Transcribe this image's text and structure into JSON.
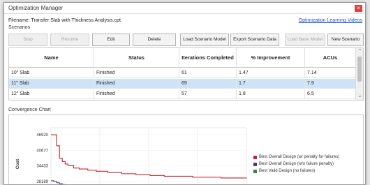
{
  "window": {
    "title": "Optimization Manager",
    "close_glyph": "×"
  },
  "file": {
    "line": "Filename: Transfer Slab with Thickness Analysis.cpt",
    "help_link": "Optimization Learning Videos"
  },
  "scenarios_label": "Scenarios",
  "toolbar": {
    "stop": "Stop",
    "resume": "Resume",
    "edit": "Edit",
    "delete": "Delete",
    "load_scenario_model": "Load Scenario Model",
    "export_scenario_data": "Export Scenario Data",
    "load_base_model": "Load Base Model",
    "new_scenario": "New Scenario"
  },
  "table": {
    "columns": [
      "Name",
      "Status",
      "Iterations Completed",
      "% Improvement",
      "ACUs"
    ],
    "rows": [
      {
        "name": "10\" Slab",
        "status": "Finished",
        "iterations": "61",
        "improvement": "1.47",
        "acus": "7.14",
        "selected": false
      },
      {
        "name": "11\" Slab",
        "status": "Finished",
        "iterations": "69",
        "improvement": "1.7",
        "acus": "7.9",
        "selected": true
      },
      {
        "name": "12\" Slab",
        "status": "Finished",
        "iterations": "57",
        "improvement": "1.8",
        "acus": "6.5",
        "selected": false
      }
    ]
  },
  "chart_title": "Convergence Chart",
  "chart_data": {
    "type": "line",
    "title": "",
    "xlabel": "",
    "ylabel": "Cost",
    "yticks": [
      46920,
      40677,
      34433,
      28189
    ],
    "ylim": [
      26500,
      48000
    ],
    "xlim": [
      0,
      69
    ],
    "grid": true,
    "legend": "right",
    "series": [
      {
        "name": "Best Overall Design (w/ penalty for failures)",
        "color": "#c8232c",
        "x": [
          0,
          1,
          2,
          3,
          4,
          5,
          6,
          8,
          10,
          13,
          16,
          20,
          25,
          30,
          35,
          40,
          50,
          60,
          69
        ],
        "y": [
          46920,
          46900,
          42500,
          37500,
          36200,
          35200,
          34600,
          33600,
          33200,
          32700,
          32300,
          31800,
          31300,
          30900,
          30600,
          30300,
          29900,
          29600,
          29400
        ]
      },
      {
        "name": "Best Overall Design (w/o failure penalty)",
        "color": "#5b2c8f",
        "x": [
          0,
          1,
          2,
          3,
          4,
          5,
          7,
          10
        ],
        "y": [
          28500,
          28200,
          27700,
          27300,
          27000,
          26800,
          26700,
          26600
        ]
      },
      {
        "name": "Best Valid Design (no failures)",
        "color": "#2e8b3a",
        "x": [],
        "y": []
      }
    ]
  }
}
